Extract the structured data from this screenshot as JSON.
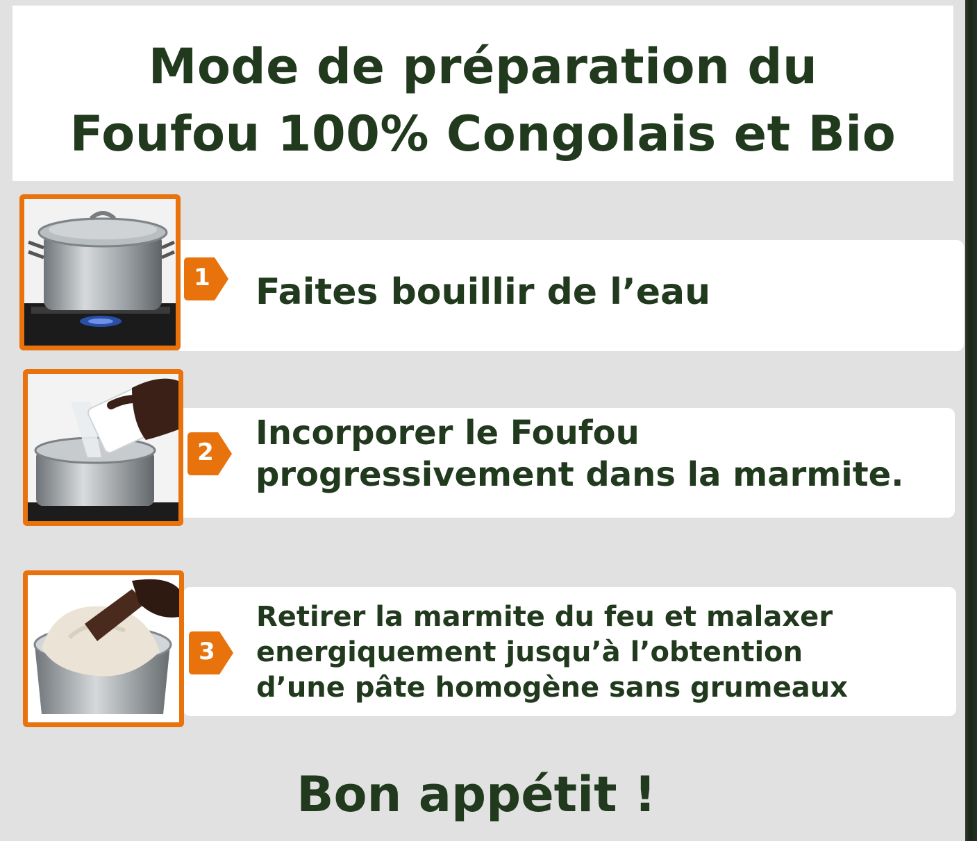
{
  "title": {
    "line1": "Mode de préparation du",
    "line2": "Foufou 100% Congolais et Bio"
  },
  "steps": [
    {
      "number": "1",
      "lines": [
        "Faites bouillir de l’eau"
      ],
      "photo_icon": "boiling-pot-icon"
    },
    {
      "number": "2",
      "lines": [
        "Incorporer le Foufou",
        "progressivement dans la marmite."
      ],
      "photo_icon": "pouring-flour-icon"
    },
    {
      "number": "3",
      "lines": [
        "Retirer la marmite du feu et malaxer",
        "energiquement jusqu’à l’obtention",
        "d’une pâte homogène sans grumeaux"
      ],
      "photo_icon": "kneading-dough-icon"
    }
  ],
  "closing": "Bon appétit !",
  "colors": {
    "background": "#e1e1e1",
    "text_green": "#213a1e",
    "accent_orange": "#e8720c",
    "card": "#ffffff"
  }
}
